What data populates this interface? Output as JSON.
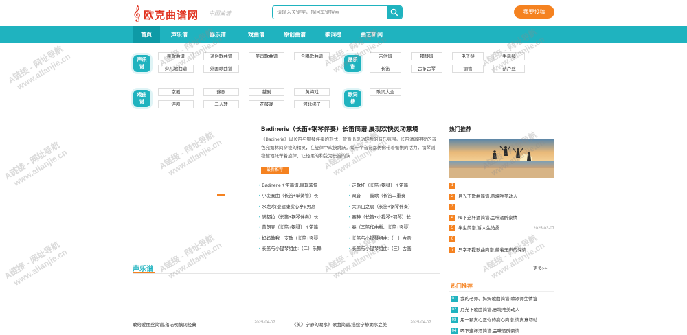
{
  "header": {
    "logo_clef": "𝄞",
    "logo_name": "欧克曲谱网",
    "logo_slogan": "中国曲谱",
    "search_placeholder": "请输入关键字，搜回车键搜索",
    "publish_label": "我要投稿"
  },
  "nav": {
    "items": [
      "首页",
      "声乐谱",
      "器乐谱",
      "戏曲谱",
      "原创曲谱",
      "歌词榜",
      "曲艺新闻"
    ]
  },
  "categories": {
    "vocal": {
      "label_1": "声乐",
      "label_2": "谱",
      "tags": [
        "民歌曲谱",
        "通俗歌曲谱",
        "美声歌曲谱",
        "合唱歌曲谱",
        "少儿歌曲谱",
        "外国歌曲谱"
      ]
    },
    "instrumental": {
      "label_1": "器乐",
      "label_2": "谱",
      "tags": [
        "吉他谱",
        "钢琴谱",
        "电子琴",
        "手风琴",
        "长笛",
        "古筝古琴",
        "钢管",
        "葫芦丝"
      ]
    },
    "opera": {
      "label_1": "戏曲",
      "label_2": "谱",
      "tags": [
        "京剧",
        "豫剧",
        "越剧",
        "黄梅戏",
        "评剧",
        "二人转",
        "花鼓戏",
        "河北梆子"
      ]
    },
    "lyrics": {
      "label_1": "歌词",
      "label_2": "榜",
      "tags": [
        "歌词大全"
      ]
    }
  },
  "featured": {
    "title": "Badinerie（长笛+钢琴伴奏）长笛简谱,展现欢快灵动意境",
    "description": "《Badinerie》以长笛与钢琴伴奏的形式，营造出灵动轻盈的音乐氛围。长笛清澈明亮的音色宛如林间穿梭的精灵，在旋律中欢快跳跃。每一个音符都仿佛带着愉悦的活力，钢琴则稳健地托举着旋律，让轻柔的和弦为长笛的演",
    "badge": "最新推荐",
    "list_left": [
      "Badinerie长笛简谱,展现欢快",
      "小变奏曲（长笛+单簧管）长",
      "水龙吟(登建康赏心亭)(男高",
      "满都拉（长笛+钢琴伴奏）长",
      "普朗克（长笛+钢琴）长笛简",
      "妈妈教我一支歌（长笛+竖琴",
      "长笛与小提琴组曲:（二）乐舞"
    ],
    "list_right": [
      "走歌圩（长笛+钢琴）长笛简",
      "双音——鼓歌（长笛二重奏",
      "大凉山之晨（长笛+钢琴伴奏）",
      "赛神（长笛+小提琴+钢琴）长",
      "春（辛笛作曲版、长笛+竖琴）",
      "长笛与小提琴组曲:（一）古意",
      "长笛与小提琴组曲:（三）古画"
    ]
  },
  "hot": {
    "title": "热门推荐",
    "items": [
      {
        "num": "1",
        "text": "",
        "date": ""
      },
      {
        "num": "2",
        "text": "月光下歌曲简谱,意境唯美动人",
        "date": ""
      },
      {
        "num": "3",
        "text": "",
        "date": ""
      },
      {
        "num": "4",
        "text": "喝下这杯酒简谱,品味酒醉豪情",
        "date": ""
      },
      {
        "num": "5",
        "text": "半生简谱,诉人生沧桑",
        "date": "2025-03-07"
      },
      {
        "num": "6",
        "text": "",
        "date": ""
      },
      {
        "num": "7",
        "text": "只字不提歌曲简谱,藏着无声的深情",
        "date": ""
      }
    ],
    "more": "更多>>"
  },
  "vocal_section": {
    "title": "声乐谱",
    "news": [
      {
        "text": "敢给爱丽丝简谱,落洁明慎词经典",
        "date": "2025-04-07"
      },
      {
        "text": "《英》宁静的湖水》歌曲简谱,描绘宁静湖水之美",
        "date": "2025-04-07"
      }
    ]
  },
  "hot2": {
    "title": "热门推荐",
    "items": [
      {
        "num": "01",
        "text": "我的老师、妈妈歌曲简谱,歌颂师生情谊"
      },
      {
        "num": "02",
        "text": "月光下歌曲简谱,意境唯美动人"
      },
      {
        "num": "03",
        "text": "用一颗真心正你的痴心简谱,情真意切动"
      },
      {
        "num": "04",
        "text": "喝下这杯酒简谱,品味酒醉豪情"
      }
    ]
  },
  "watermark": {
    "line1": "A链接 - 网址导航",
    "line2": "www.allanjie.cn"
  },
  "colors": {
    "accent": "#1fb3bf",
    "accent_dark": "#0e9aa6",
    "orange": "#f58220",
    "brand_red": "#e0321f"
  }
}
